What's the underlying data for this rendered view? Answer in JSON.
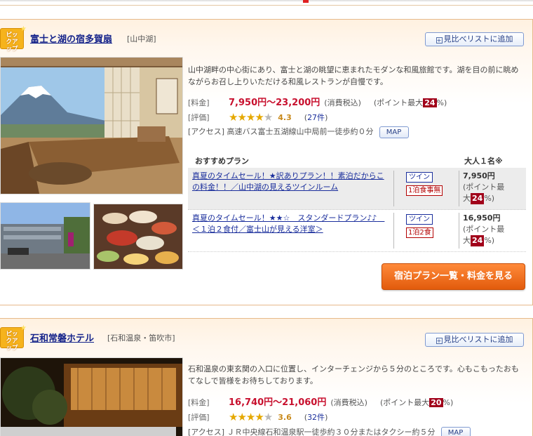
{
  "hotel1": {
    "badge_label": "ピックアップ",
    "name": "富士と湖の宿多賀扇",
    "area": "[山中湖]",
    "compare_label": "見比べリストに追加",
    "description": "山中湖畔の中心街にあり、富士と湖の眺望に恵まれたモダンな和風旅館です。湖を目の前に眺めながらお召し上りいただける和風レストランが自慢です。",
    "price_label": "[料金]",
    "price_range": "7,950円〜23,200円",
    "tax_note": "(消費税込)",
    "points_prefix": "(ポイント最大",
    "points_pct": "24",
    "points_suffix": "%)",
    "rating_label": "[評価]",
    "rating_score": "4.3",
    "rating_stars": 4,
    "reviews_link": "27件",
    "access_label": "[アクセス]",
    "access_text": "高速バス富士五湖線山中局前一徒歩約０分",
    "map_label": "MAP",
    "plans_header_left": "おすすめプラン",
    "plans_header_right": "大人１名※",
    "plans": [
      {
        "name": "真夏のタイムセール！★訳ありプラン！！素泊だからこの料金！！／山中湖の見えるツインルーム",
        "room": "ツイン",
        "meal": "1泊食事無",
        "price": "7,950円",
        "points_prefix": "(ポイント最",
        "points_mid": "大",
        "points_pct": "24",
        "points_suffix": "%)"
      },
      {
        "name": "真夏のタイムセール！★★☆　スタンダードプラン♪♪　＜１泊２食付／富士山が見える洋室＞",
        "room": "ツイン",
        "meal": "1泊2食",
        "price": "16,950円",
        "points_prefix": "(ポイント最",
        "points_mid": "大",
        "points_pct": "24",
        "points_suffix": "%)"
      }
    ],
    "cta_label": "宿泊プラン一覧・料金を見る"
  },
  "hotel2": {
    "badge_label": "ピックアップ",
    "name": "石和常磐ホテル",
    "area": "[石和温泉・笛吹市]",
    "compare_label": "見比べリストに追加",
    "description": "石和温泉の東玄関の入口に位置し、インターチェンジから５分のところです。心もこもったおもてなしで皆様をお待ちしております。",
    "price_label": "[料金]",
    "price_range": "16,740円〜21,060円",
    "tax_note": "(消費税込)",
    "points_prefix": "(ポイント最大",
    "points_pct": "20",
    "points_suffix": "%)",
    "rating_label": "[評価]",
    "rating_score": "3.6",
    "rating_stars": 4,
    "reviews_link": "32件",
    "access_label": "[アクセス]",
    "access_text": "ＪＲ中央線石和温泉駅一徒歩約３０分またはタクシー約５分",
    "map_label": "MAP"
  },
  "colors": {
    "accent": "#c8102e",
    "link": "#1a2e9c",
    "cta": "#e25b0c",
    "badge": "#f6b31c",
    "points_bg": "#a1001a"
  },
  "icons": [
    "compare-icon",
    "star-icon",
    "pickup-badge-icon"
  ]
}
